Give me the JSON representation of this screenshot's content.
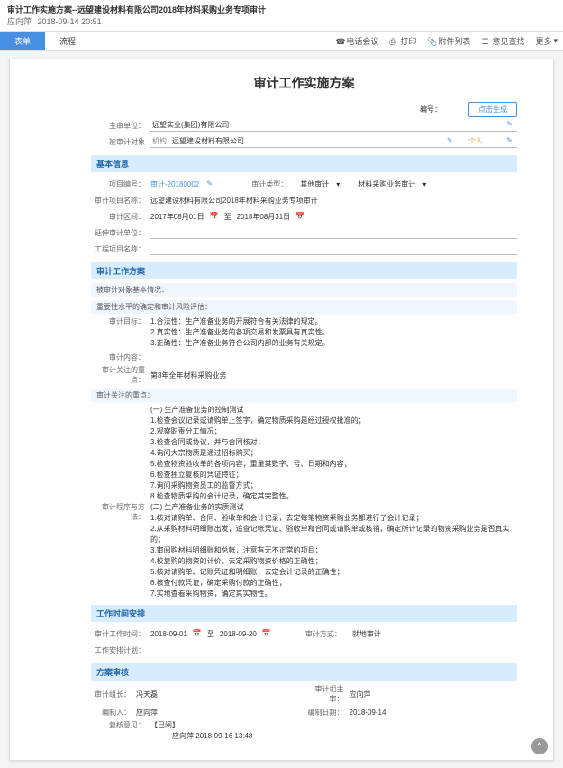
{
  "titlebar": {
    "title": "审计工作实施方案--远望建设材料有限公司2018年材料采购业务专项审计",
    "user": "应向萍",
    "time": "2018-09-14 20:51"
  },
  "tabs": {
    "form": "表单",
    "flow": "流程"
  },
  "tools": {
    "call": "电话会议",
    "print": "打印",
    "attach": "附件列表",
    "opinion": "意见查找",
    "more": "更多"
  },
  "doc": {
    "title": "审计工作实施方案"
  },
  "header": {
    "code_label": "编号：",
    "gen_btn": "点击生成",
    "zhushen_label": "主审单位：",
    "zhushen": "远望实业(集团)有限公司",
    "beishen_label": "被审计对象",
    "jigou": "机构",
    "beishen": "远望建设材料有限公司",
    "geren": "个人"
  },
  "basic": {
    "head": "基本信息",
    "proj_code_label": "项目编号：",
    "proj_code": "审计-20180002",
    "cat_label": "审计类型：",
    "cat": "其他审计",
    "sub": "材料采购业务审计",
    "proj_name_label": "审计项目名称：",
    "proj_name": "远望建设材料有限公司2018年材料采购业务专项审计",
    "range_label": "审计区间：",
    "d1": "2017年08月01日",
    "to": "至",
    "d2": "2018年08月31日",
    "yanshen_label": "延伸审计单位：",
    "gongcheng_label": "工程项目名称："
  },
  "plan": {
    "head": "审计工作方案",
    "sub1": "被审计对象基本情况：",
    "sub2": "重要性水平的确定和审计风险评估：",
    "mubiao_label": "审计目标：",
    "mubiao": "1.合法性：生产准备业务的开展符合有关法律的规定。\n2.真实性：生产准备业务的各项交易和发票具有真实性。\n3.正确性：生产准备业务符合公司内部的业务有关规定。",
    "neirong_label": "审计内容：",
    "guanzhu_label": "审计关注的重点：",
    "guanzhu": "第8年全年材料采购业务",
    "sub3": "审计关注的重点：",
    "points": "(一) 生产准备业务的控制测试\n1.检查会议记录或请购单上签字，确定物质采购是经过授权批准的；\n2.观察职责分工情况；\n3.检查合同或协议，并与合同核对；\n4.询问大宗物质是通过招标购买；\n5.检查物资验收单的各项内容；重量其数字、号、日期和内容；\n6.检查独立复核的凭证特征；\n7.询问采购物资员工的监督方式；\n8.检查物质采购的会计记录，确定其完整性。",
    "method_label": "审计程序与方法：",
    "method": "(二) 生产准备业务的实质测试\n1.核对请购单、合同、验收单和会计记录，去定每笔物资采购业务都进行了会计记录；\n2.从采购材料明细账出发，追查记帐凭证、验收单和合同或请购单或核销，确定所计记录的物资采购业务是否真实的；\n3.审阅购材料明细账和总帐，注意有无不正常的项目；\n4.校复购的物资的计价，去定采购物资价格的正确性；\n5.核对请购单、记账凭证和明细账，去定会计记录的正确性；\n6.核查付款凭证，确定采购付款的正确性；\n7.实地查看采购物资，确定其实物性。",
    "sched": "工作时间安排",
    "st_label": "审计工作时间：",
    "st": "2018-09-01",
    "et": "2018-09-20",
    "fs_label": "审计方式：",
    "fs": "就地审计",
    "arr_label": "工作安排计划：",
    "review": "方案审核",
    "leader_label": "审计组长：",
    "leader": "冯天磊",
    "chief_label": "审计组主审：",
    "chief": "应向萍",
    "author_label": "编制人：",
    "author": "应向萍",
    "adate_label": "编制日期：",
    "adate": "2018-09-14",
    "fh_label": "复核意见：",
    "fh_status": "【已阅】",
    "fh_sig": "应向萍 2018-09-16 13:48"
  }
}
